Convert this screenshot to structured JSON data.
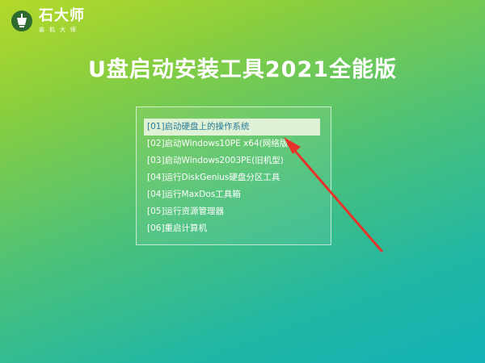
{
  "logo": {
    "name": "石大师",
    "subtitle": "装机大师",
    "icon": "stone-logo-icon"
  },
  "title": "U盘启动安装工具2021全能版",
  "menu": {
    "selected_index": 0,
    "items": [
      {
        "label": "[01]启动硬盘上的操作系统"
      },
      {
        "label": "[02]启动Windows10PE x64(网络版)"
      },
      {
        "label": "[03]启动Windows2003PE(旧机型)"
      },
      {
        "label": "[04]运行DiskGenius硬盘分区工具"
      },
      {
        "label": "[04]运行MaxDos工具箱"
      },
      {
        "label": "[05]运行资源管理器"
      },
      {
        "label": "[06]重启计算机"
      }
    ]
  },
  "annotation": {
    "icon": "red-arrow-icon",
    "color": "#e8332a"
  }
}
